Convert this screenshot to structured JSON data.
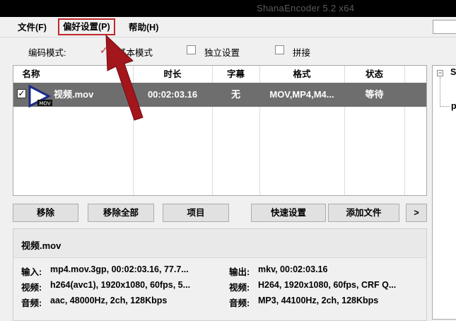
{
  "window": {
    "title": "ShanaEncoder 5.2 x64"
  },
  "menu": {
    "items": [
      "文件(F)",
      "偏好设置(P)",
      "帮助(H)"
    ]
  },
  "encode_mode": {
    "label": "编码模式:",
    "options": [
      {
        "label": "基本模式",
        "checked": true
      },
      {
        "label": "独立设置",
        "checked": false
      },
      {
        "label": "拼接",
        "checked": false
      }
    ]
  },
  "file_list": {
    "headers": [
      "名称",
      "时长",
      "字幕",
      "格式",
      "状态"
    ],
    "rows": [
      {
        "checked": true,
        "icon_badge": "MOV",
        "name": "视频.mov",
        "duration": "00:02:03.16",
        "subtitle": "无",
        "format": "MOV,MP4,M4...",
        "status": "等待"
      }
    ]
  },
  "buttons": {
    "remove": "移除",
    "remove_all": "移除全部",
    "item": "项目",
    "quick_settings": "快速设置",
    "add_file": "添加文件",
    "more": ">"
  },
  "tree": {
    "node_prefix_1": "S",
    "node_prefix_2": "p"
  },
  "info": {
    "filename": "视频.mov",
    "input_label": "输入:",
    "input_value": "mp4.mov.3gp, 00:02:03.16, 77.7...",
    "output_label": "输出:",
    "output_value": "mkv, 00:02:03.16",
    "video_label": "视频:",
    "input_video": "h264(avc1), 1920x1080, 60fps, 5...",
    "output_video": "H264, 1920x1080, 60fps, CRF Q...",
    "audio_label": "音频:",
    "input_audio": "aac, 48000Hz, 2ch, 128Kbps",
    "output_audio": "MP3, 44100Hz, 2ch, 128Kbps"
  },
  "colors": {
    "highlight_red": "#c0272d",
    "selected_row": "#6e6e6e",
    "play_icon": "#1a2a8a"
  }
}
